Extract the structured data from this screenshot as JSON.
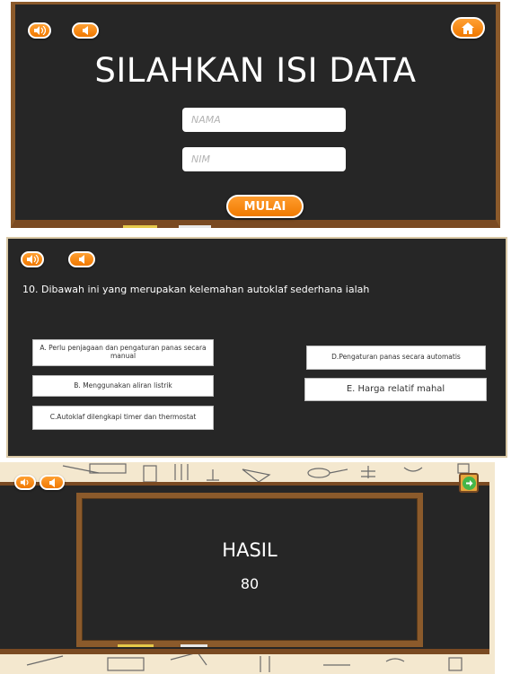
{
  "login_screen": {
    "title": "SILAHKAN ISI DATA",
    "name_placeholder": "NAMA",
    "nim_placeholder": "NIM",
    "start_label": "MULAI",
    "sound_icon": "speaker-icon",
    "back_icon": "back-icon",
    "home_icon": "home-icon"
  },
  "quiz_screen": {
    "question": "10.  Dibawah ini yang merupakan kelemahan autoklaf sederhana ialah",
    "answers": {
      "a": "A. Perlu penjagaan dan pengaturan panas secara manual",
      "b": "B. Menggunakan aliran listrik",
      "c": "C.Autoklaf dilengkapi timer dan thermostat",
      "d": "D.Pengaturan panas secara automatis",
      "e": "E. Harga relatif mahal"
    }
  },
  "result_screen": {
    "title": "HASIL",
    "score": "80"
  },
  "colors": {
    "chalkboard": "#262626",
    "wood_frame": "#8b5a2b",
    "button_orange": "#f07800",
    "next_green": "#44b649"
  }
}
